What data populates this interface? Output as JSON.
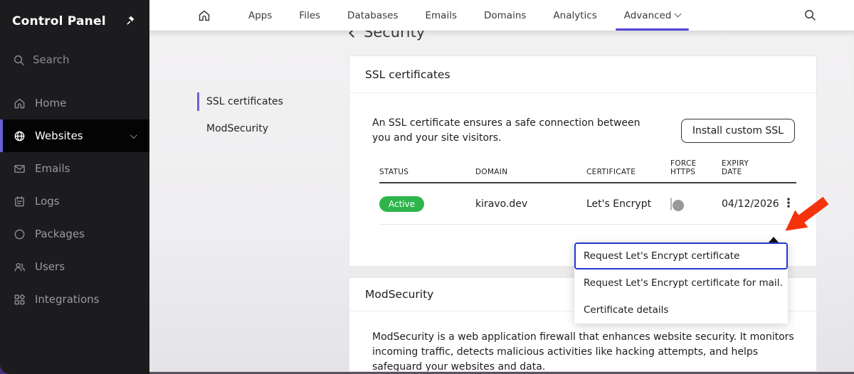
{
  "sidebar": {
    "title": "Control Panel",
    "search_label": "Search",
    "items": [
      {
        "label": "Home"
      },
      {
        "label": "Websites"
      },
      {
        "label": "Emails"
      },
      {
        "label": "Logs"
      },
      {
        "label": "Packages"
      },
      {
        "label": "Users"
      },
      {
        "label": "Integrations"
      }
    ]
  },
  "topnav": {
    "tabs": [
      "Apps",
      "Files",
      "Databases",
      "Emails",
      "Domains",
      "Analytics",
      "Advanced"
    ]
  },
  "page": {
    "heading": "Security"
  },
  "secondary_nav": {
    "items": [
      "SSL certificates",
      "ModSecurity"
    ]
  },
  "ssl_card": {
    "title": "SSL certificates",
    "description": "An SSL certificate ensures a safe connection between you and your site visitors.",
    "install_button": "Install custom SSL",
    "table": {
      "headers": [
        "STATUS",
        "DOMAIN",
        "CERTIFICATE",
        "FORCE HTTPS",
        "EXPIRY DATE"
      ],
      "row": {
        "status": "Active",
        "domain": "kiravo.dev",
        "certificate": "Let's Encrypt",
        "force_https_enabled": false,
        "expiry_date": "04/12/2026"
      }
    }
  },
  "dropdown_menu": {
    "items": [
      "Request Let's Encrypt certificate",
      "Request Let's Encrypt certificate for mail.",
      "Certificate details"
    ]
  },
  "modsecurity_card": {
    "title": "ModSecurity",
    "description": "ModSecurity is a web application firewall that enhances website security. It monitors incoming traffic, detects malicious activities like hacking attempts, and helps safeguard your websites and data."
  },
  "colors": {
    "accent_purple": "#6b5fd6",
    "tab_underline": "#5145d9",
    "badge_green": "#2eb44b",
    "focus_blue": "#2337d3",
    "arrow_red": "#f5330a",
    "sidebar_bg": "#1c1b1d"
  }
}
